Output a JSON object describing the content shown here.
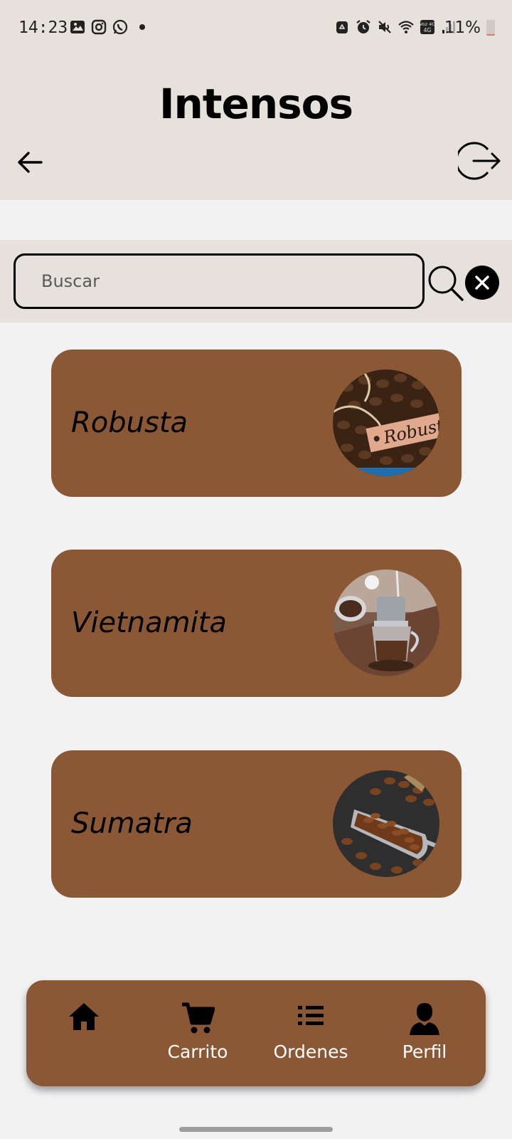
{
  "status_bar": {
    "time": "14:23",
    "battery": "11%",
    "left_icons": [
      "gallery-icon",
      "instagram-icon",
      "whatsapp-icon",
      "notification-dot-icon"
    ],
    "right_icons": [
      "recycle-icon",
      "alarm-icon",
      "mute-icon",
      "wifi-icon",
      "volte-icon",
      "signal-icon",
      "battery-icon"
    ],
    "volte_label": "Voz 4G",
    "battery_level": 0.11
  },
  "header": {
    "title": "Intensos",
    "back_icon": "arrow-left-icon",
    "logout_icon": "logout-icon"
  },
  "search": {
    "placeholder": "Buscar",
    "value": "",
    "search_icon": "search-icon",
    "clear_icon": "close-icon"
  },
  "products": [
    {
      "name": "Robusta",
      "image": "robusta-beans-image",
      "tag_text": "Robusta"
    },
    {
      "name": "Vietnamita",
      "image": "vietnamese-coffee-filter-image"
    },
    {
      "name": "Sumatra",
      "image": "coffee-beans-scoop-image"
    }
  ],
  "bottom_nav": {
    "items": [
      {
        "label": "",
        "icon": "home-icon"
      },
      {
        "label": "Carrito",
        "icon": "cart-icon"
      },
      {
        "label": "Ordenes",
        "icon": "list-icon"
      },
      {
        "label": "Perfil",
        "icon": "user-icon"
      }
    ]
  },
  "colors": {
    "header_bg": "#e6e1da",
    "page_bg": "#f2f2f2",
    "card_bg": "#8b5835",
    "nav_bg": "#8b5835"
  }
}
